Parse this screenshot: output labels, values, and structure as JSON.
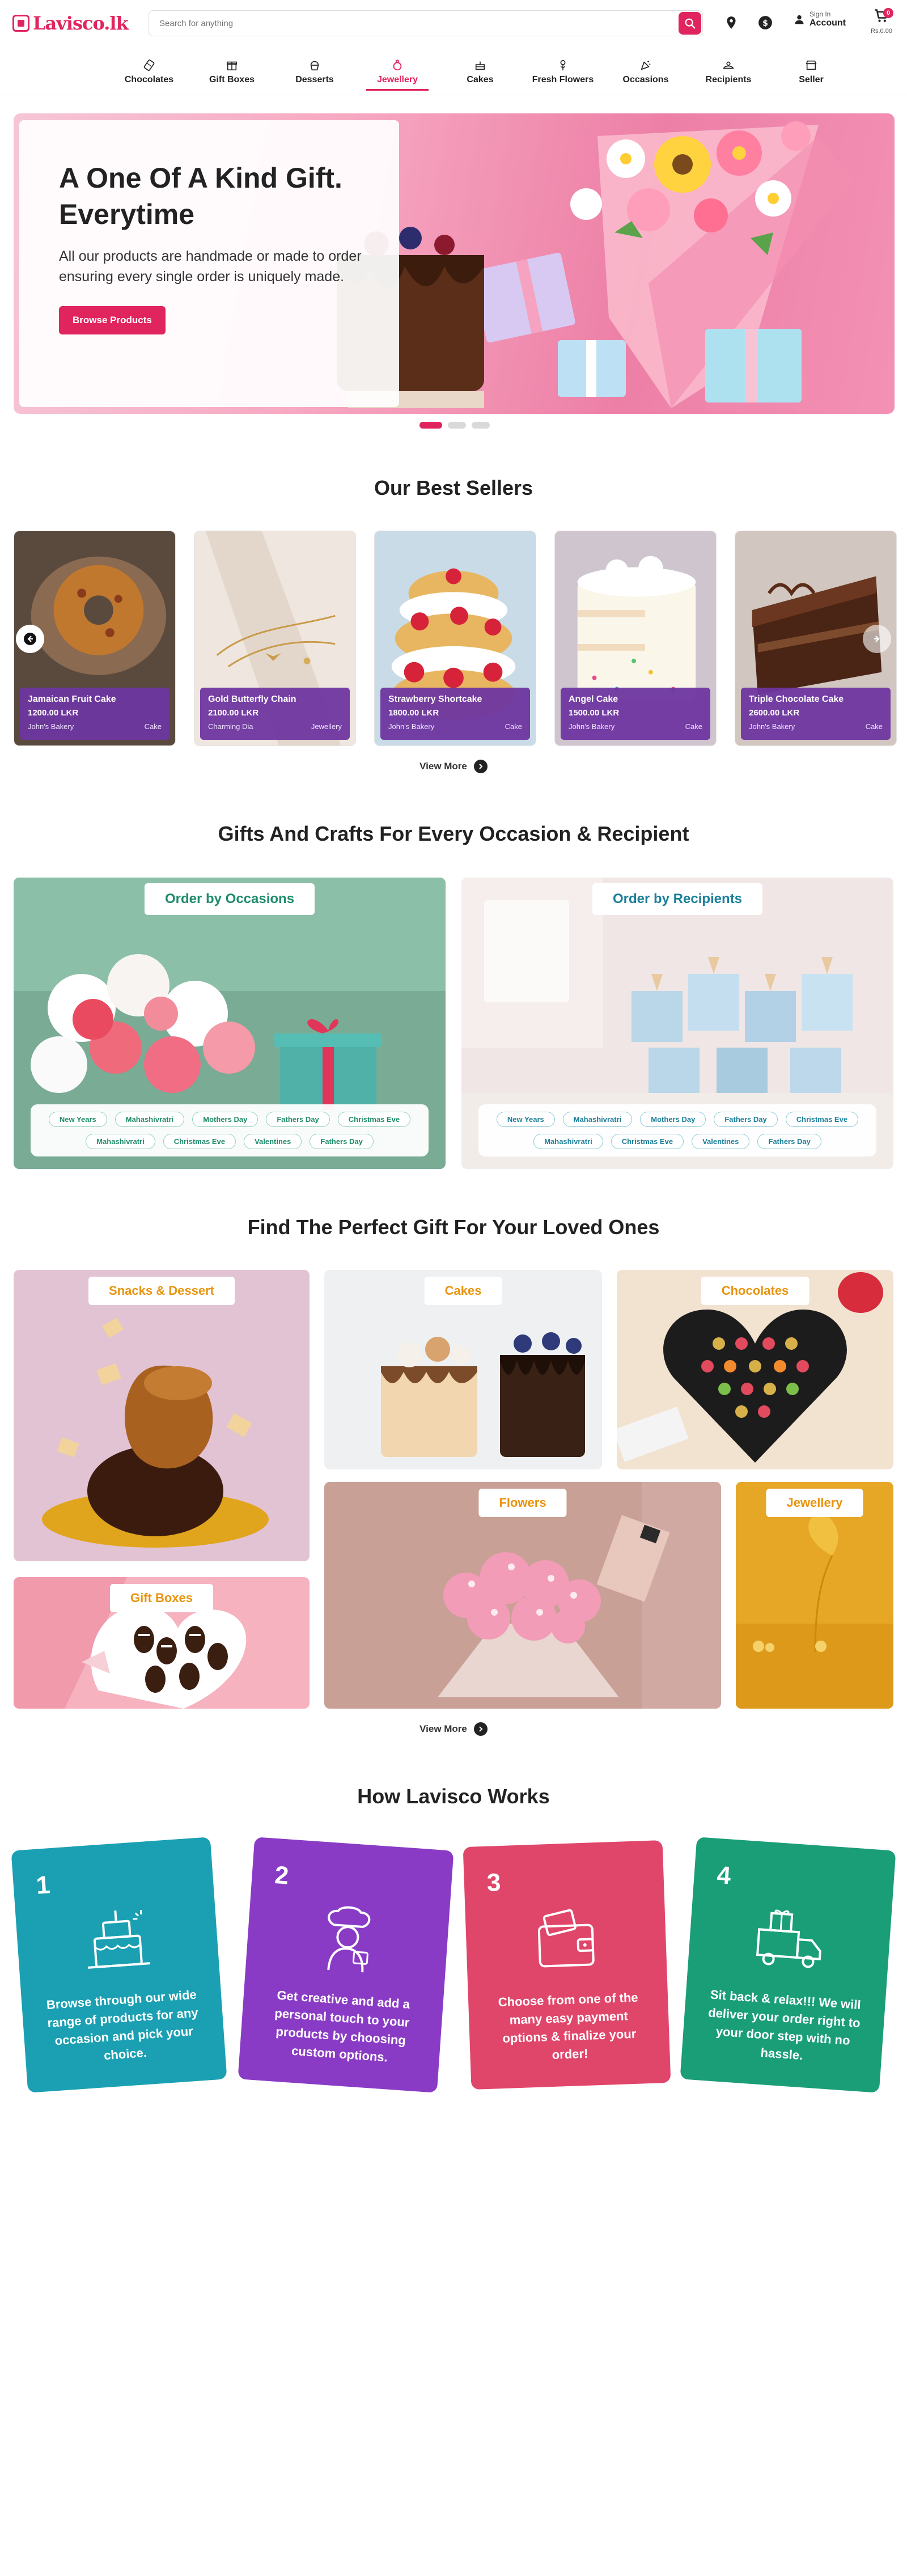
{
  "header": {
    "logo_text": "Lavisco.lk",
    "search_placeholder": "Search for anything",
    "account_small": "Sign In",
    "account_big": "Account",
    "cart_count": "0",
    "cart_total": "Rs.0.00"
  },
  "nav": {
    "items": [
      {
        "label": "Chocolates"
      },
      {
        "label": "Gift Boxes"
      },
      {
        "label": "Desserts"
      },
      {
        "label": "Jewellery"
      },
      {
        "label": "Cakes"
      },
      {
        "label": "Fresh Flowers"
      },
      {
        "label": "Occasions"
      },
      {
        "label": "Recipients"
      },
      {
        "label": "Seller"
      }
    ],
    "active": "Jewellery"
  },
  "hero": {
    "title": "A One Of A Kind Gift. Everytime",
    "subtitle": "All our products are handmade or made to order ensuring every single order is uniquely made.",
    "button": "Browse Products",
    "slides": 3,
    "active_slide": 1
  },
  "best_sellers": {
    "title": "Our Best Sellers",
    "products": [
      {
        "name": "Jamaican Fruit Cake",
        "price": "1200.00 LKR",
        "seller": "John's Bakery",
        "category": "Cake"
      },
      {
        "name": "Gold Butterfly Chain",
        "price": "2100.00 LKR",
        "seller": "Charming Dia",
        "category": "Jewellery"
      },
      {
        "name": "Strawberry Shortcake",
        "price": "1800.00 LKR",
        "seller": "John's Bakery",
        "category": "Cake"
      },
      {
        "name": "Angel Cake",
        "price": "1500.00 LKR",
        "seller": "John's Bakery",
        "category": "Cake"
      },
      {
        "name": "Triple Chocolate Cake",
        "price": "2600.00 LKR",
        "seller": "John's Bakery",
        "category": "Cake"
      }
    ],
    "view_more": "View More"
  },
  "occasions": {
    "title": "Gifts And Crafts For Every Occasion & Recipient",
    "occasions_label": "Order by Occasions",
    "recipients_label": "Order by Recipients",
    "occasion_tags": [
      "New Years",
      "Mahashivratri",
      "Mothers Day",
      "Fathers Day",
      "Christmas Eve",
      "Mahashivratri",
      "Christmas Eve",
      "Valentines",
      "Fathers Day"
    ],
    "recipient_tags": [
      "New Years",
      "Mahashivratri",
      "Mothers Day",
      "Fathers Day",
      "Christmas Eve",
      "Mahashivratri",
      "Christmas Eve",
      "Valentines",
      "Fathers Day"
    ]
  },
  "gifts": {
    "title": "Find The Perfect Gift For Your Loved Ones",
    "categories": {
      "snacks": "Snacks & Dessert",
      "cakes": "Cakes",
      "chocolates": "Chocolates",
      "flowers": "Flowers",
      "jewellery": "Jewellery",
      "gift_boxes": "Gift Boxes"
    },
    "view_more": "View More"
  },
  "how": {
    "title": "How Lavisco Works",
    "steps": [
      {
        "num": "1",
        "text": "Browse through our wide range of products for any occasion and pick your choice.",
        "color": "#1aa0b2"
      },
      {
        "num": "2",
        "text": "Get creative and add a personal touch to your products by choosing custom options.",
        "color": "#8a3bc5"
      },
      {
        "num": "3",
        "text": "Choose from one of the many easy payment options & finalize your order!",
        "color": "#e0466a"
      },
      {
        "num": "4",
        "text": "Sit back & relax!!! We will deliver your order right to your door step with no hassle.",
        "color": "#1a9e78"
      }
    ]
  },
  "colors": {
    "brand": "#e0245e",
    "purple_card": "#6e36a0",
    "gift_label": "#e8940f",
    "tag_green": "#1f8c6b"
  }
}
